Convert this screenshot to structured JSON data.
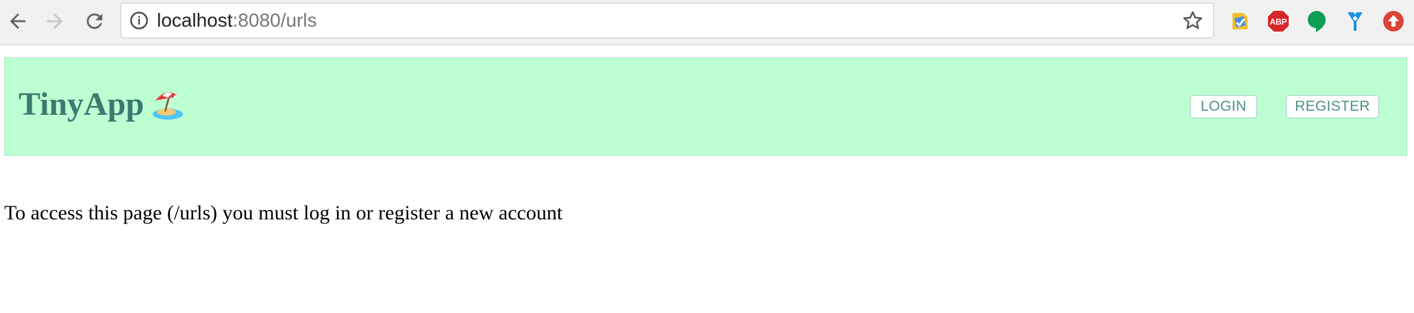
{
  "browser": {
    "url_host": "localhost",
    "url_path": ":8080/urls",
    "extensions": [
      {
        "name": "google-keep-icon"
      },
      {
        "name": "adblock-plus-icon",
        "label": "ABP"
      },
      {
        "name": "hangouts-icon"
      },
      {
        "name": "vimeo-icon"
      },
      {
        "name": "upload-icon"
      }
    ]
  },
  "page": {
    "brand": "TinyApp",
    "brand_icon": "beach-umbrella-island-icon",
    "login_label": "LOGIN",
    "register_label": "REGISTER",
    "message": "To access this page (/urls) you must log in or register a new account"
  },
  "colors": {
    "header_bg": "#bcffd3",
    "brand_text": "#3a7a70",
    "button_text": "#4a8f86"
  }
}
